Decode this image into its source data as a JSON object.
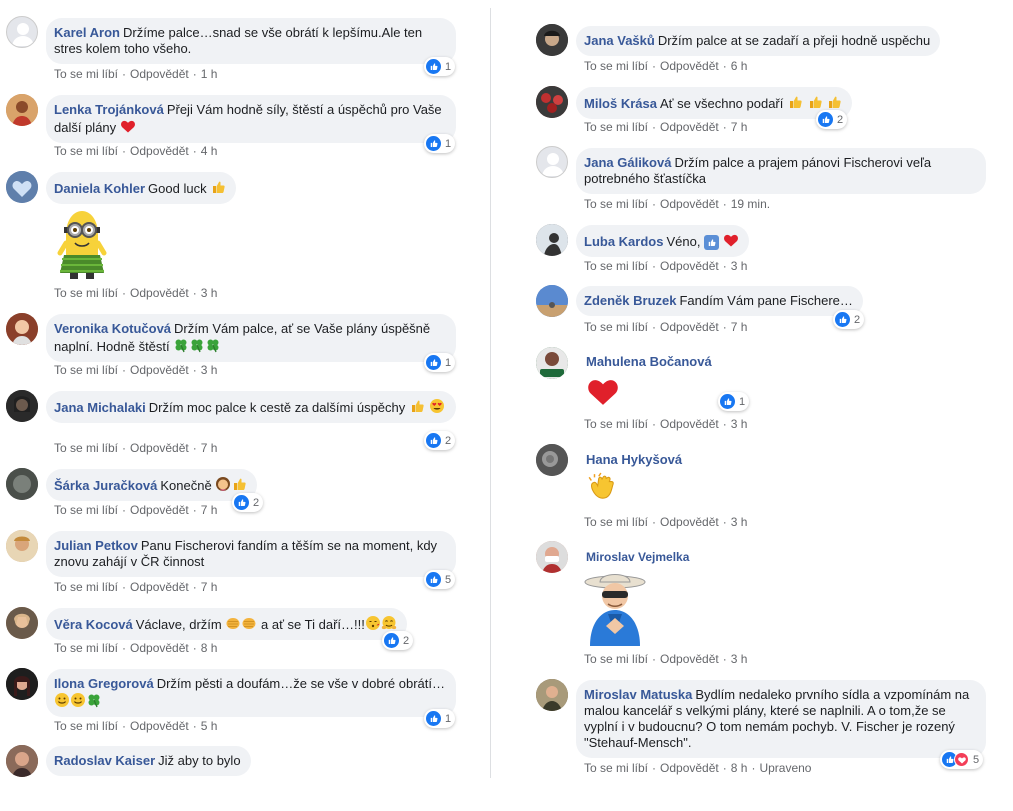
{
  "actions": {
    "like": "To se mi líbí",
    "reply": "Odpovědět",
    "edited": "Upraveno"
  },
  "left": [
    {
      "author": "Karel Aron",
      "text": "Držíme palce…snad se vše obrátí k lepšímu.Ale ten stres kolem toho všeho.",
      "time": "1 h",
      "reactions": "1"
    },
    {
      "author": "Lenka Trojánková",
      "text": "Přeji Vám hodně síly, štěstí a úspěchů pro Vaše další plány",
      "time": "4 h",
      "reactions": "1"
    },
    {
      "author": "Daniela Kohler",
      "text": "Good luck",
      "time": "3 h"
    },
    {
      "author": "Veronika Kotučová",
      "text": "Držím Vám palce, ať se Vaše plány úspěšně naplní. Hodně štěstí",
      "time": "3 h",
      "reactions": "1"
    },
    {
      "author": "Jana Michalaki",
      "text": "Držím moc palce k cestě za dalšími úspěchy",
      "time": "7 h",
      "reactions": "2"
    },
    {
      "author": "Šárka Juračková",
      "text": "Konečně",
      "time": "7 h",
      "reactions": "2"
    },
    {
      "author": "Julian Petkov",
      "text": "Panu Fischerovi fandím a těším se na moment, kdy znovu zahájí v ČR činnost",
      "time": "7 h",
      "reactions": "5"
    },
    {
      "author": "Věra Kocová",
      "text": "Václave, držím",
      "text2": "a ať se Ti daří…!!!",
      "time": "8 h",
      "reactions": "2"
    },
    {
      "author": "Ilona Gregorová",
      "text": "Držím pěsti a doufám…že se vše v dobré obrátí…",
      "time": "5 h",
      "reactions": "1"
    },
    {
      "author": "Radoslav Kaiser",
      "text": "Již aby to bylo"
    }
  ],
  "right": [
    {
      "author": "Jana Vašků",
      "text": "Držím palce at se zadaří a přeji hodně uspěchu",
      "time": "6 h"
    },
    {
      "author": "Miloš Krása",
      "text": "Ať se všechno podaří",
      "time": "7 h",
      "reactions": "2"
    },
    {
      "author": "Jana Gáliková",
      "text": "Držím palce a prajem pánovi Fischerovi veľa potrebného šťastíčka",
      "time": "19 min."
    },
    {
      "author": "Luba Kardos",
      "text": "Véno,",
      "time": "3 h"
    },
    {
      "author": "Zdeněk Bruzek",
      "text": "Fandím Vám pane Fischere…",
      "time": "7 h",
      "reactions": "2"
    },
    {
      "author": "Mahulena Bočanová",
      "time": "3 h",
      "reactions": "1"
    },
    {
      "author": "Hana Hykyšová",
      "time": "3 h"
    },
    {
      "author": "Miroslav Vejmelka",
      "time": "3 h"
    },
    {
      "author": "Miroslav Matuska",
      "text": "Bydlím nedaleko prvního sídla a vzpomínám na malou kancelář s velkými plány, které se naplnili. A o tom,že se vyplní i v budoucnu? O tom nemám pochyb. V. Fischer je rozený \"Stehauf-Mensch\".",
      "time": "8 h",
      "reactions": "5"
    }
  ],
  "colors": {
    "link": "#385898",
    "bubble": "#f0f2f5",
    "meta": "#65676b",
    "like": "#1877f2",
    "love": "#f33e58"
  }
}
